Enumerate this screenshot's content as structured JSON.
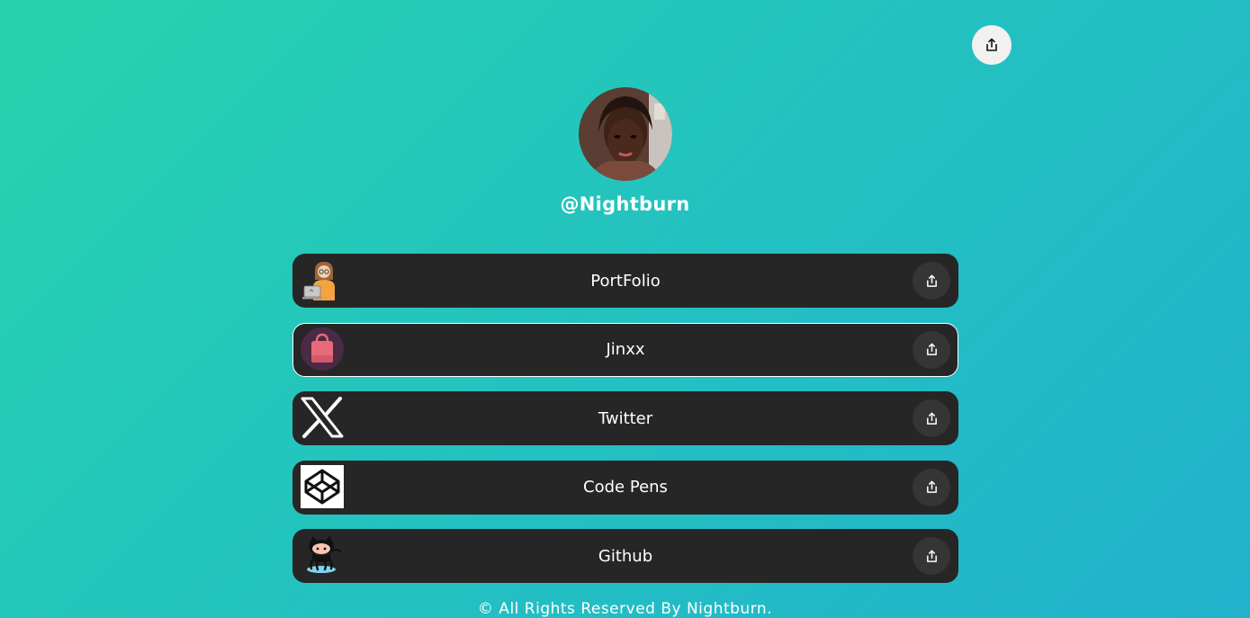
{
  "header": {
    "share_icon": "share-icon"
  },
  "profile": {
    "username": "@Nightburn",
    "avatar_icon": "profile-photo"
  },
  "links": [
    {
      "label": "PortFolio",
      "icon": "developer-illustration-icon",
      "share_icon": "share-icon"
    },
    {
      "label": "Jinxx",
      "icon": "shopping-bag-icon",
      "share_icon": "share-icon"
    },
    {
      "label": "Twitter",
      "icon": "x-logo-icon",
      "share_icon": "share-icon"
    },
    {
      "label": "Code Pens",
      "icon": "codepen-logo-icon",
      "share_icon": "share-icon"
    },
    {
      "label": "Github",
      "icon": "octocat-icon",
      "share_icon": "share-icon"
    }
  ],
  "footer": {
    "text": "© All Rights Reserved By Nightburn."
  },
  "colors": {
    "background_start": "#26d3ad",
    "background_end": "#22b2cc",
    "card": "#262626",
    "share_button": "#353535",
    "text": "#ffffff"
  }
}
